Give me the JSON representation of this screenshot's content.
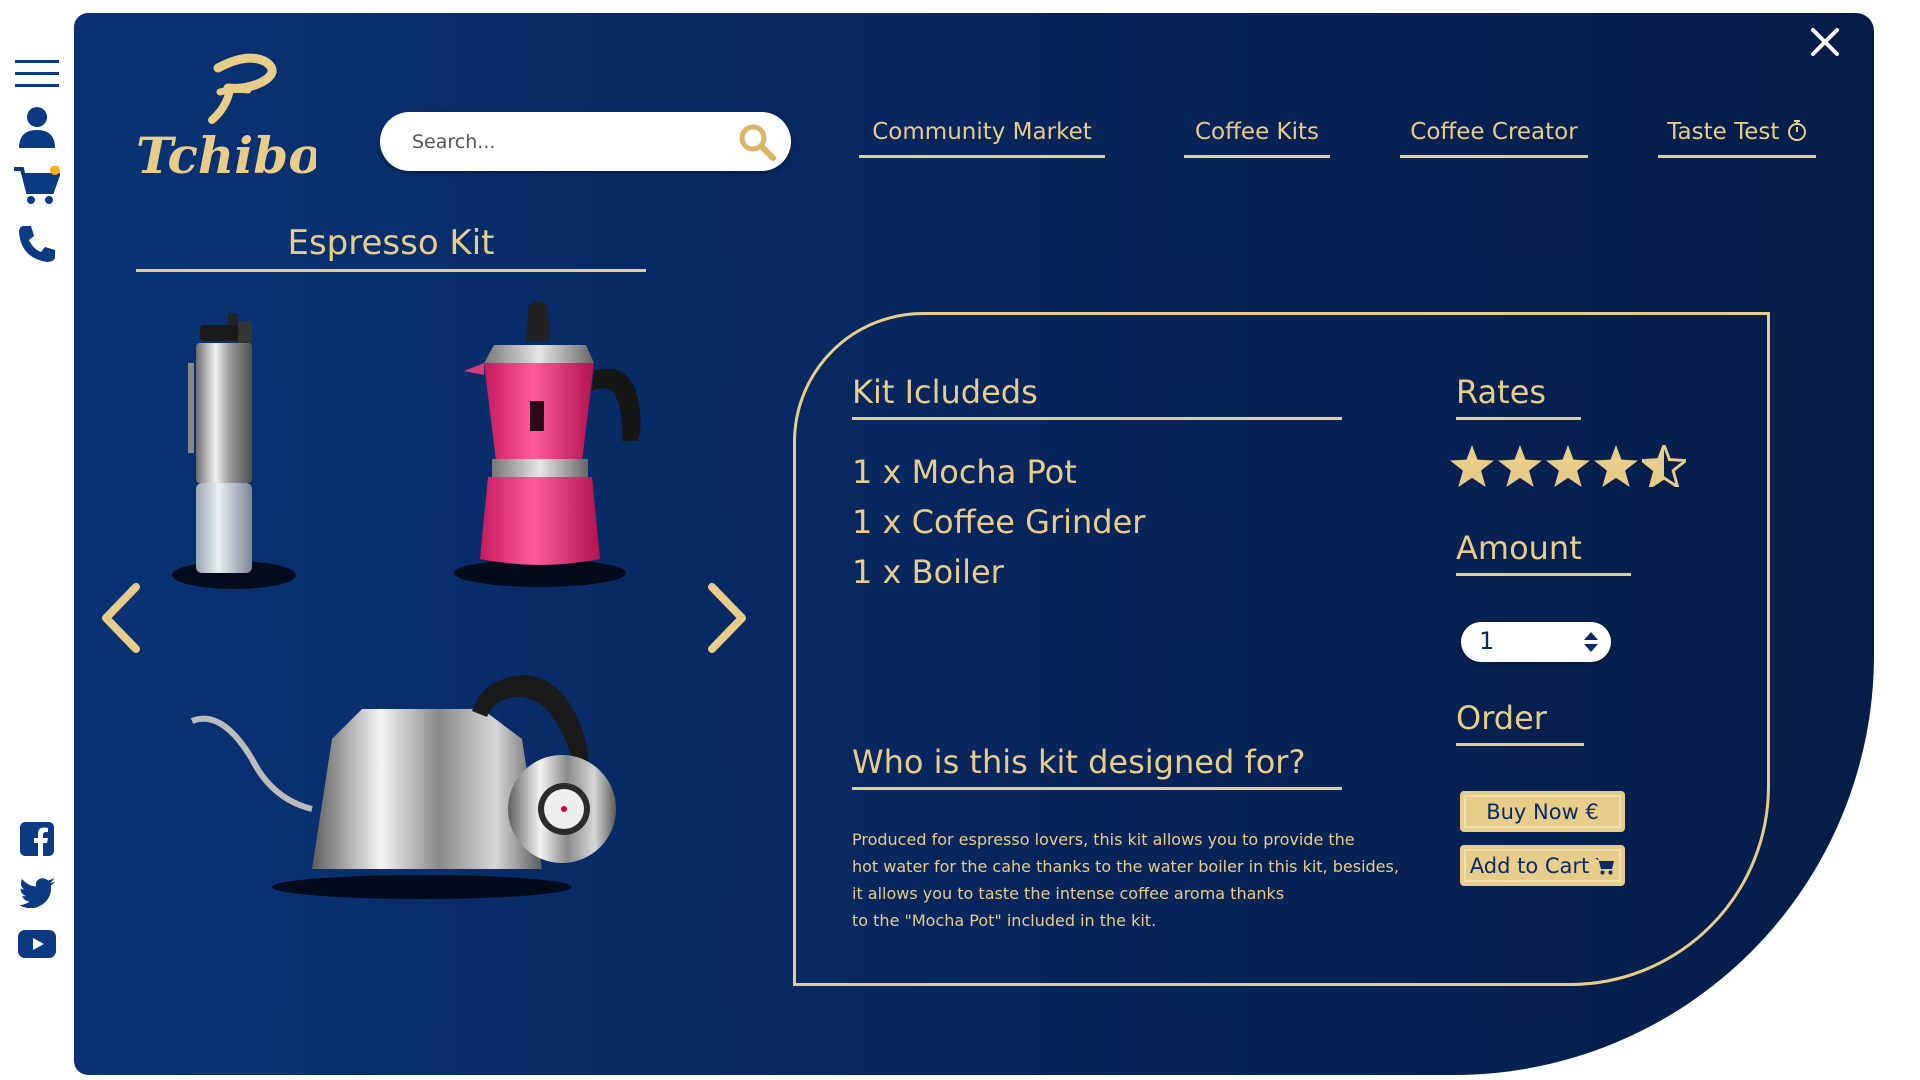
{
  "brand": {
    "name": "Tchibo",
    "accent": "#e8cc8a",
    "background": "#093375"
  },
  "sidebar": {
    "top_icons": [
      "menu-icon",
      "user-icon",
      "cart-icon",
      "phone-icon"
    ],
    "social_icons": [
      "facebook-icon",
      "twitter-icon",
      "youtube-icon"
    ]
  },
  "search": {
    "placeholder": "Search...",
    "value": ""
  },
  "nav": [
    {
      "label": "Community Market"
    },
    {
      "label": "Coffee Kits"
    },
    {
      "label": "Coffee Creator"
    },
    {
      "label": "Taste Test",
      "icon": "stopwatch-icon"
    }
  ],
  "gallery": {
    "title": "Espresso Kit",
    "products": [
      "coffee-grinder",
      "mocha-pot",
      "kettle"
    ]
  },
  "details": {
    "includes_title": "Kit Icludeds",
    "items": [
      "1 x Mocha Pot",
      "1 x Coffee Grinder",
      "1 x Boiler"
    ],
    "rates_title": "Rates",
    "rating": 4.5,
    "rating_max": 5,
    "amount_title": "Amount",
    "amount_value": "1",
    "order_title": "Order",
    "buy_label": "Buy Now €",
    "cart_label": "Add to Cart",
    "who_title": "Who is this kit designed for?",
    "description_lines": [
      "Produced for espresso lovers, this kit allows you to provide the",
      "hot water for the cahe thanks to the water boiler in this kit, besides,",
      "it allows you to taste the intense coffee aroma thanks",
      "to the \"Mocha Pot\" included in the kit."
    ]
  }
}
